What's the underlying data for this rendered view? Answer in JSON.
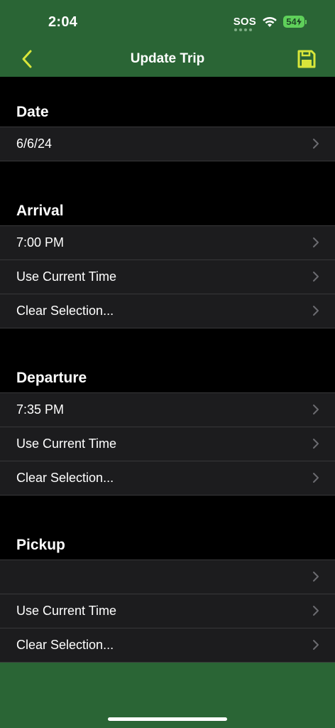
{
  "status_bar": {
    "time": "2:04",
    "sos": "SOS",
    "battery": "54"
  },
  "nav": {
    "title": "Update Trip"
  },
  "sections": {
    "date": {
      "title": "Date",
      "rows": [
        "6/6/24"
      ]
    },
    "arrival": {
      "title": "Arrival",
      "rows": [
        "7:00 PM",
        "Use Current Time",
        "Clear Selection..."
      ]
    },
    "departure": {
      "title": "Departure",
      "rows": [
        "7:35 PM",
        "Use Current Time",
        "Clear Selection..."
      ]
    },
    "pickup": {
      "title": "Pickup",
      "rows": [
        "",
        "Use Current Time",
        "Clear Selection..."
      ]
    }
  },
  "colors": {
    "header_bg": "#2a6535",
    "accent_yellow": "#d8e63a",
    "row_bg": "#1c1c1e",
    "separator": "#38383a",
    "chevron": "#6b6b70"
  },
  "icons": {
    "back": "chevron-left-icon",
    "save": "floppy-disk-icon",
    "row_disclosure": "chevron-right-icon"
  }
}
